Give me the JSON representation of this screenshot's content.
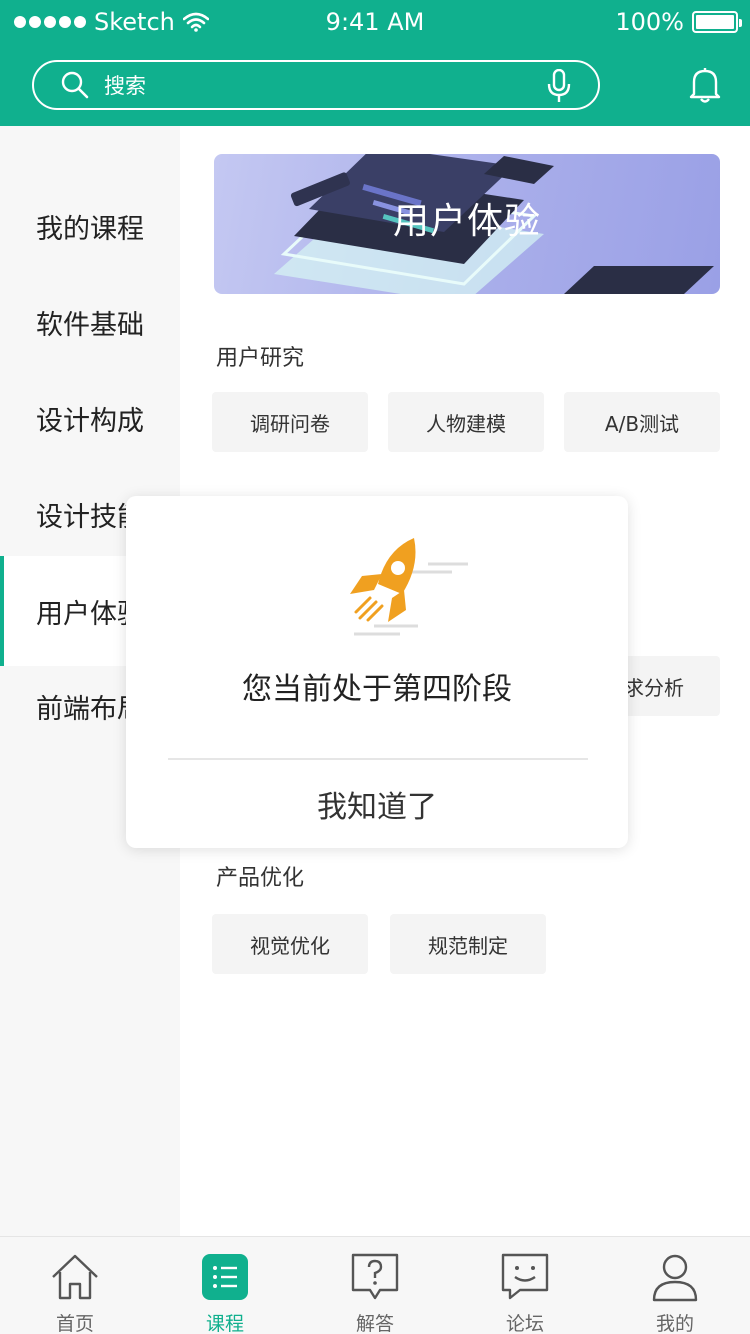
{
  "status_bar": {
    "carrier": "Sketch",
    "time": "9:41 AM",
    "battery": "100%"
  },
  "search": {
    "placeholder": "搜索"
  },
  "sidebar": {
    "items": [
      {
        "label": "我的课程"
      },
      {
        "label": "软件基础"
      },
      {
        "label": "设计构成"
      },
      {
        "label": "设计技能"
      },
      {
        "label": "用户体验",
        "active": true
      },
      {
        "label": "前端布局"
      }
    ]
  },
  "banner": {
    "title": "用户体验"
  },
  "sections": [
    {
      "title": "用户研究",
      "chips": [
        "调研问卷",
        "人物建模",
        "A/B测试"
      ]
    },
    {
      "partial_chip": "求分析"
    },
    {
      "title": "产品优化",
      "chips": [
        "视觉优化",
        "规范制定"
      ]
    }
  ],
  "dialog": {
    "message": "您当前处于第四阶段",
    "confirm": "我知道了"
  },
  "tabbar": {
    "items": [
      {
        "label": "首页",
        "icon": "home-icon"
      },
      {
        "label": "课程",
        "icon": "course-list-icon",
        "active": true
      },
      {
        "label": "解答",
        "icon": "question-bubble-icon"
      },
      {
        "label": "论坛",
        "icon": "forum-chat-icon"
      },
      {
        "label": "我的",
        "icon": "profile-icon"
      }
    ]
  },
  "colors": {
    "brand": "#10b08e",
    "rocket": "#f0a020",
    "banner": "#a9aeea"
  }
}
